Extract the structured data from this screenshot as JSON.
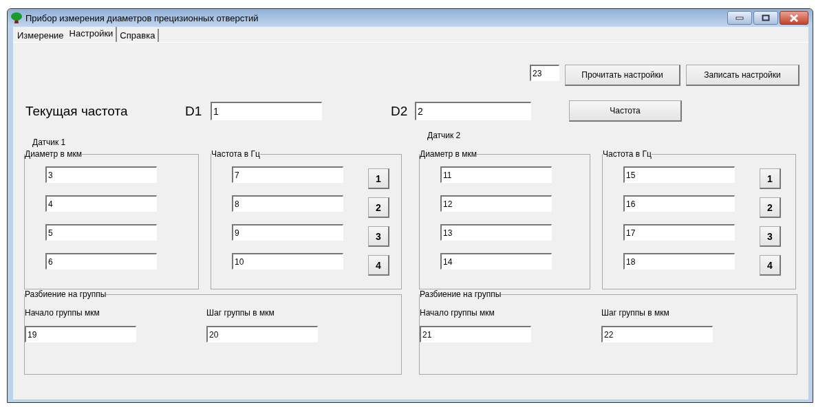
{
  "window": {
    "title": "Прибор измерения диаметров прецизионных отверстий"
  },
  "tabs": [
    {
      "label": "Измерение",
      "selected": false
    },
    {
      "label": "Настройки",
      "selected": true
    },
    {
      "label": "Справка",
      "selected": false
    }
  ],
  "settings_number": {
    "value": "23"
  },
  "settings_buttons": [
    "Прочитать настройки",
    "Записать настройки"
  ],
  "current_frequency": {
    "label": "Текущая частота",
    "d1_label": "D1",
    "d1_value": "1",
    "d2_label": "D2",
    "d2_value": "2",
    "button": "Частота"
  },
  "sensors": [
    {
      "title": "Датчик 1",
      "diameter": {
        "title": "Диаметр в мкм",
        "values": [
          "3",
          "4",
          "5",
          "6"
        ]
      },
      "frequency": {
        "title": "Частота в Гц",
        "values": [
          "7",
          "8",
          "9",
          "10"
        ],
        "buttons": [
          "1",
          "2",
          "3",
          "4"
        ]
      },
      "grouping": {
        "title": "Разбиение на группы",
        "start_label": "Начало группы мкм",
        "start_value": "19",
        "step_label": "Шаг группы в мкм",
        "step_value": "20"
      }
    },
    {
      "title": "Датчик 2",
      "diameter": {
        "title": "Диаметр в мкм",
        "values": [
          "11",
          "12",
          "13",
          "14"
        ]
      },
      "frequency": {
        "title": "Частота в Гц",
        "values": [
          "15",
          "16",
          "17",
          "18"
        ],
        "buttons": [
          "1",
          "2",
          "3",
          "4"
        ]
      },
      "grouping": {
        "title": "Разбиение на группы",
        "start_label": "Начало группы мкм",
        "start_value": "21",
        "step_label": "Шаг группы в мкм",
        "step_value": "22"
      }
    }
  ]
}
